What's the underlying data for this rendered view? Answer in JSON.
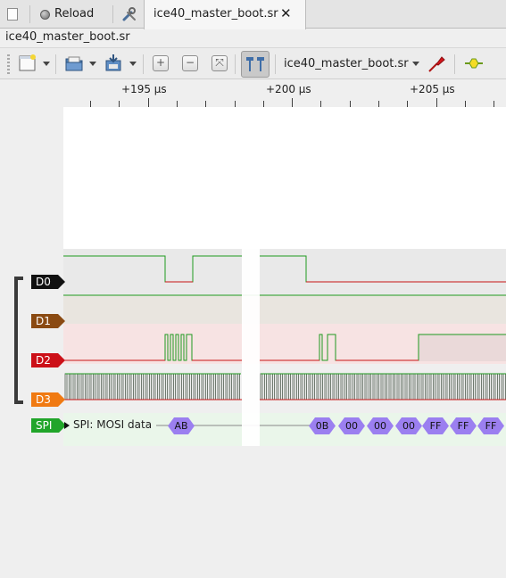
{
  "tabs": {
    "reload_label": "Reload",
    "active_tab_label": "ice40_master_boot.sr",
    "close_icon": "✕"
  },
  "session": {
    "title": "ice40_master_boot.sr"
  },
  "toolbar": {
    "device_selector": "ice40_master_boot.sr",
    "zoom_in": "+",
    "zoom_out": "−",
    "zoom_fit": "⤧"
  },
  "ruler": {
    "labels": [
      "+195 µs",
      "+200 µs",
      "+205 µs"
    ]
  },
  "channels": [
    {
      "name": "D0",
      "color": "#111111"
    },
    {
      "name": "D1",
      "color": "#8a4a12"
    },
    {
      "name": "D2",
      "color": "#cc1018"
    },
    {
      "name": "D3",
      "color": "#f07a12"
    }
  ],
  "decoder": {
    "tag": "SPI",
    "tag_color": "#21a52a",
    "row_label": "SPI: MOSI data",
    "annotations": [
      "AB",
      "0B",
      "00",
      "00",
      "00",
      "FF",
      "FF",
      "FF"
    ]
  },
  "colors": {
    "high_trace": "#1f9a1f",
    "low_trace": "#c81414",
    "annotation_fill": "#9b7ff0"
  }
}
